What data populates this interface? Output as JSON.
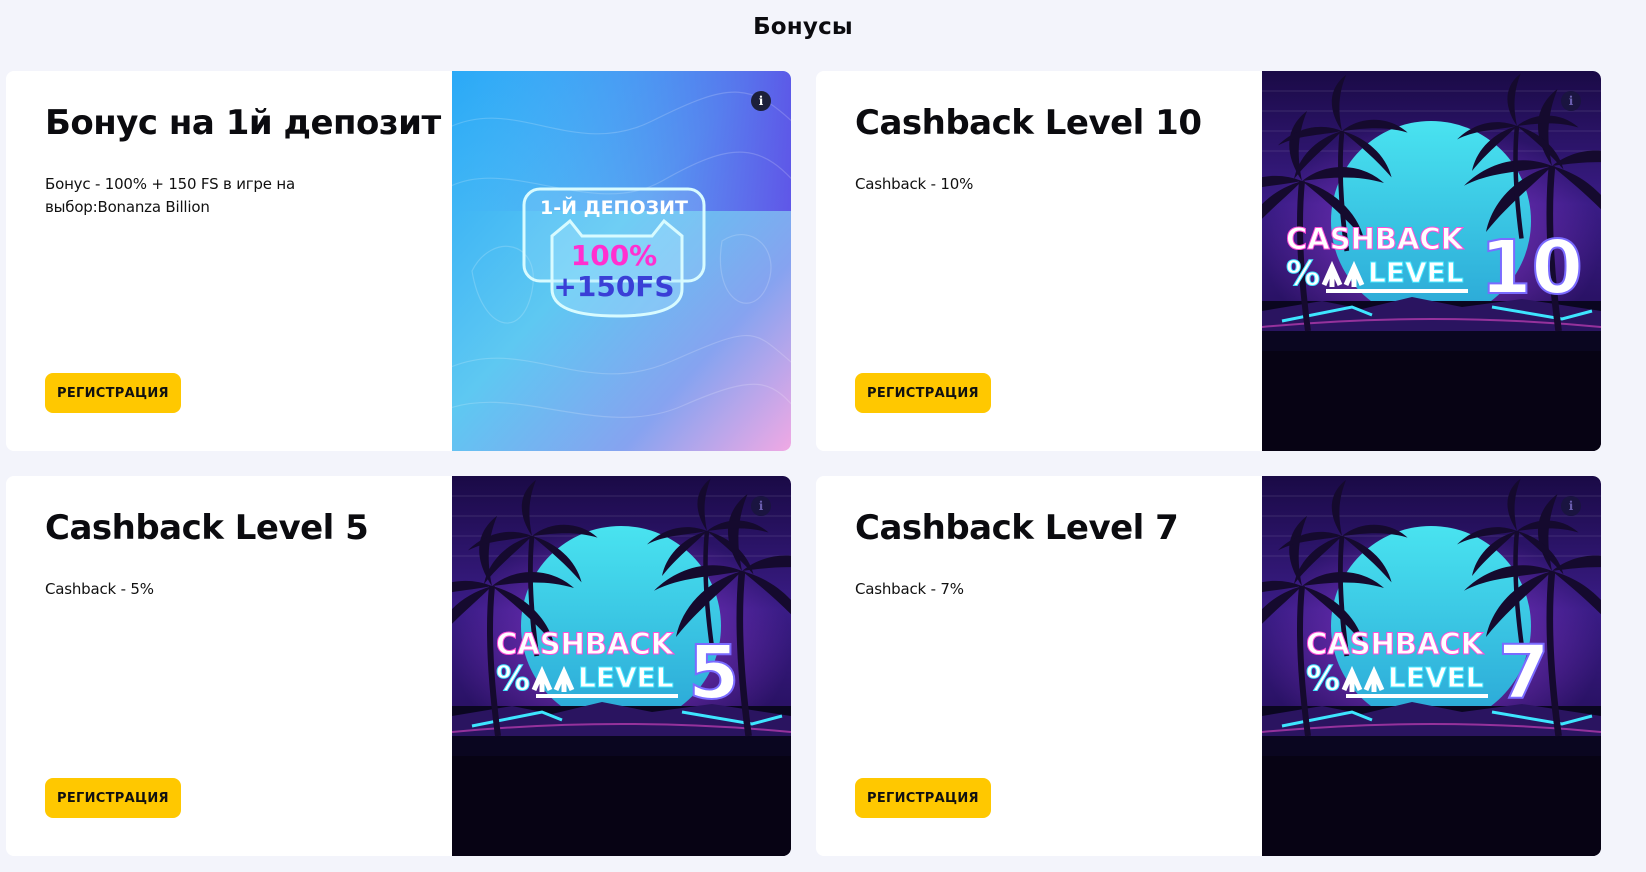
{
  "page": {
    "title": "Бонусы"
  },
  "cards": [
    {
      "title": "Бонус на 1й депозит",
      "description": "Бонус - 100% + 150 FS в игре на выбор:Bonanza Billion",
      "button": "РЕГИСТРАЦИЯ",
      "info": "i",
      "image": {
        "line1": "1-Й ДЕПОЗИТ",
        "line2": "100%",
        "line3": "+150FS"
      }
    },
    {
      "title": "Cashback Level 10",
      "description": "Cashback - 10%",
      "button": "РЕГИСТРАЦИЯ",
      "info": "i",
      "image": {
        "word1": "CASHBACK",
        "word2": "LEVEL",
        "percent": "%",
        "number": "10"
      }
    },
    {
      "title": "Cashback Level 5",
      "description": "Cashback - 5%",
      "button": "РЕГИСТРАЦИЯ",
      "info": "i",
      "image": {
        "word1": "CASHBACK",
        "word2": "LEVEL",
        "percent": "%",
        "number": "5"
      }
    },
    {
      "title": "Cashback Level 7",
      "description": "Cashback - 7%",
      "button": "РЕГИСТРАЦИЯ",
      "info": "i",
      "image": {
        "word1": "CASHBACK",
        "word2": "LEVEL",
        "percent": "%",
        "number": "7"
      }
    }
  ],
  "colors": {
    "page_bg": "#f3f4fb",
    "card_bg": "#ffffff",
    "button_bg": "#ffc800",
    "cashback_sky_top": "#1c0b4a",
    "cashback_sun": "#3fd6e8",
    "deposit_gradient_start": "#2fb6f5",
    "deposit_gradient_end": "#e9a6e8",
    "accent_pink": "#ff2fd0"
  },
  "icons": {
    "info": "info-icon"
  }
}
